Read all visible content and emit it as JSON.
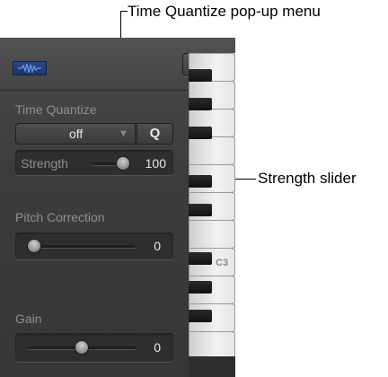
{
  "callouts": {
    "time_quantize": "Time Quantize pop-up menu",
    "strength": "Strength slider"
  },
  "header": {
    "waveform_icon": "waveform-icon",
    "menu_icon": "disclosure-triangle-icon"
  },
  "time_quantize": {
    "label": "Time Quantize",
    "value": "off",
    "arrow": "▼",
    "q_button": "Q"
  },
  "strength": {
    "label": "Strength",
    "value": "100",
    "level": 1.0
  },
  "pitch_correction": {
    "label": "Pitch Correction",
    "value": "0",
    "level": 0.0
  },
  "gain": {
    "label": "Gain",
    "value": "0",
    "level": 0.5
  },
  "keyboard": {
    "c3_label": "C3"
  }
}
